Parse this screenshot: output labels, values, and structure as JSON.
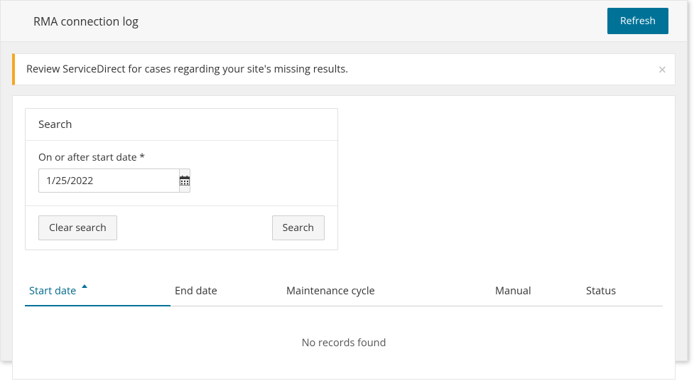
{
  "header": {
    "title": "RMA connection log",
    "refresh_label": "Refresh"
  },
  "alert": {
    "message": "Review ServiceDirect for cases regarding your site's missing results.",
    "close_label": "×"
  },
  "search": {
    "card_title": "Search",
    "date_label": "On or after start date *",
    "date_value": "1/25/2022",
    "clear_label": "Clear search",
    "search_label": "Search"
  },
  "table": {
    "columns": {
      "start_date": "Start date",
      "end_date": "End date",
      "maintenance_cycle": "Maintenance cycle",
      "manual": "Manual",
      "status": "Status"
    },
    "empty_message": "No records found"
  }
}
